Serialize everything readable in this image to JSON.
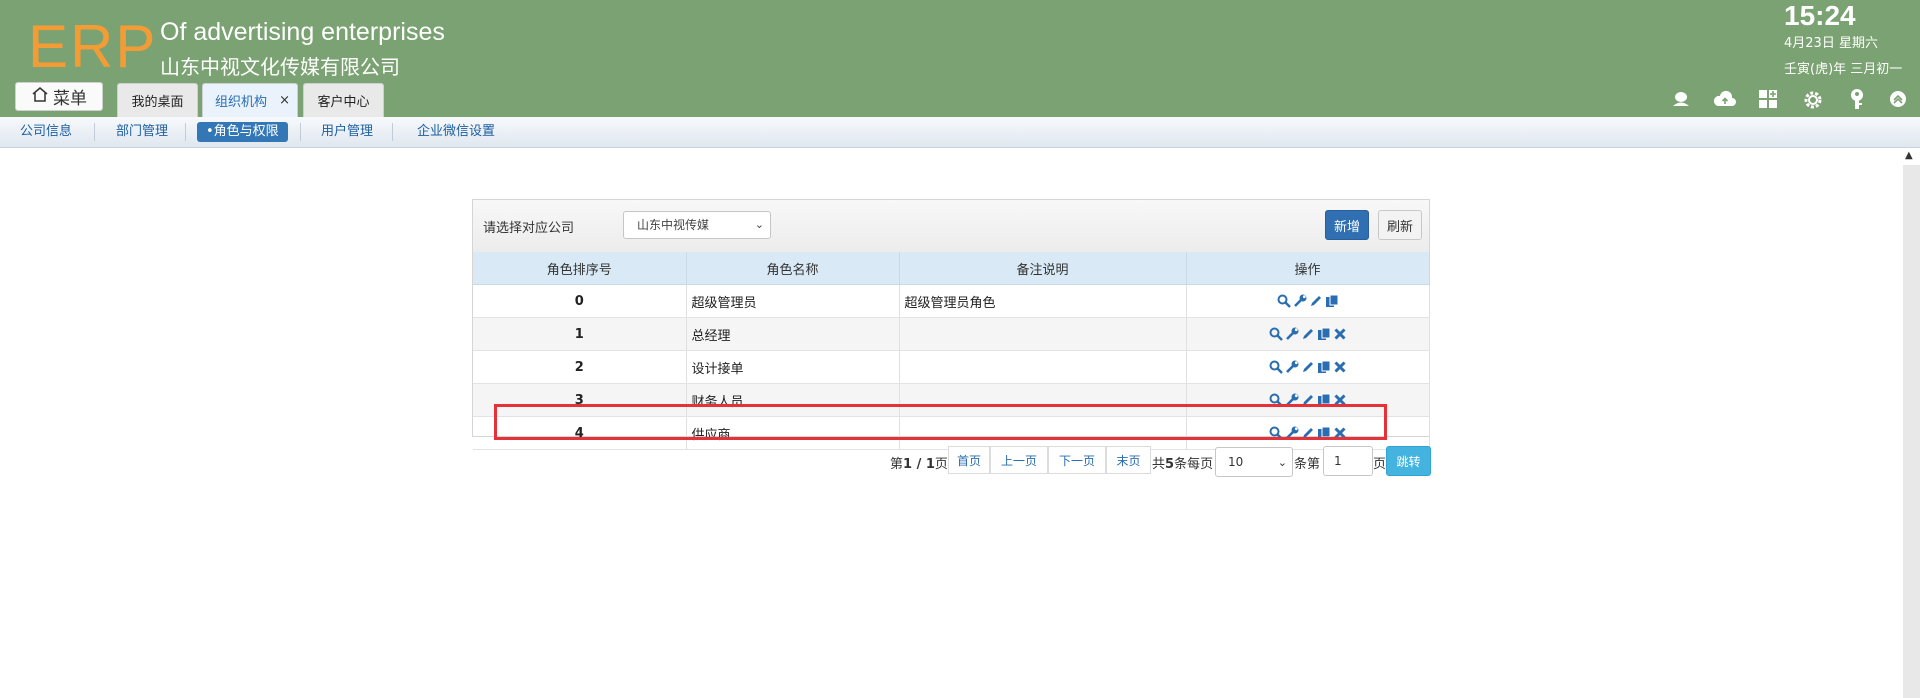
{
  "header": {
    "logo": "ERP",
    "company_en": "Of advertising enterprises",
    "company_cn": "山东中视文化传媒有限公司",
    "time": "15:24",
    "date": "4月23日 星期六",
    "lunar": "壬寅(虎)年 三月初一",
    "menu_label": "菜单"
  },
  "tabs": [
    {
      "label": "我的桌面"
    },
    {
      "label": "组织机构",
      "active": true,
      "close": "×"
    },
    {
      "label": "客户中心"
    }
  ],
  "toolbar_icons": [
    "user-icon",
    "cloud-icon",
    "apps-icon",
    "settings-icon",
    "key-icon",
    "collapse-icon"
  ],
  "subnav": [
    {
      "label": "公司信息"
    },
    {
      "label": "部门管理"
    },
    {
      "label": "•角色与权限",
      "active": true
    },
    {
      "label": "用户管理"
    },
    {
      "label": "企业微信设置"
    }
  ],
  "panel": {
    "company_label": "请选择对应公司",
    "company_value": "山东中视传媒",
    "new_btn": "新增",
    "refresh_btn": "刷新"
  },
  "table": {
    "headers": [
      "角色排序号",
      "角色名称",
      "备注说明",
      "操作"
    ],
    "rows": [
      {
        "order": "0",
        "name": "超级管理员",
        "note": "超级管理员角色",
        "ops": [
          "view",
          "config",
          "edit",
          "copy"
        ]
      },
      {
        "order": "1",
        "name": "总经理",
        "note": "",
        "ops": [
          "view",
          "config",
          "edit",
          "copy",
          "delete"
        ]
      },
      {
        "order": "2",
        "name": "设计接单",
        "note": "",
        "ops": [
          "view",
          "config",
          "edit",
          "copy",
          "delete"
        ]
      },
      {
        "order": "3",
        "name": "财务人员",
        "note": "",
        "ops": [
          "view",
          "config",
          "edit",
          "copy",
          "delete"
        ]
      },
      {
        "order": "4",
        "name": "供应商",
        "note": "",
        "ops": [
          "view",
          "config",
          "edit",
          "copy",
          "delete"
        ]
      }
    ]
  },
  "pager": {
    "page_info_pre": "第",
    "page_info_cur": "1",
    "page_info_sep": " / ",
    "page_info_total": "1",
    "page_info_post": "页",
    "first": "首页",
    "prev": "上一页",
    "next": "下一页",
    "last": "末页",
    "total_pre": "共",
    "total_count": "5",
    "total_post": "条每页",
    "page_size": "10",
    "goto_pre": "条第",
    "goto_value": "1",
    "goto_post": "页",
    "jump": "跳转"
  },
  "colors": {
    "header_bg": "#7ba272",
    "logo": "#f39c36",
    "accent_blue": "#2f6fb2",
    "highlight_red": "#e53238",
    "jump_btn": "#45b3e0"
  }
}
